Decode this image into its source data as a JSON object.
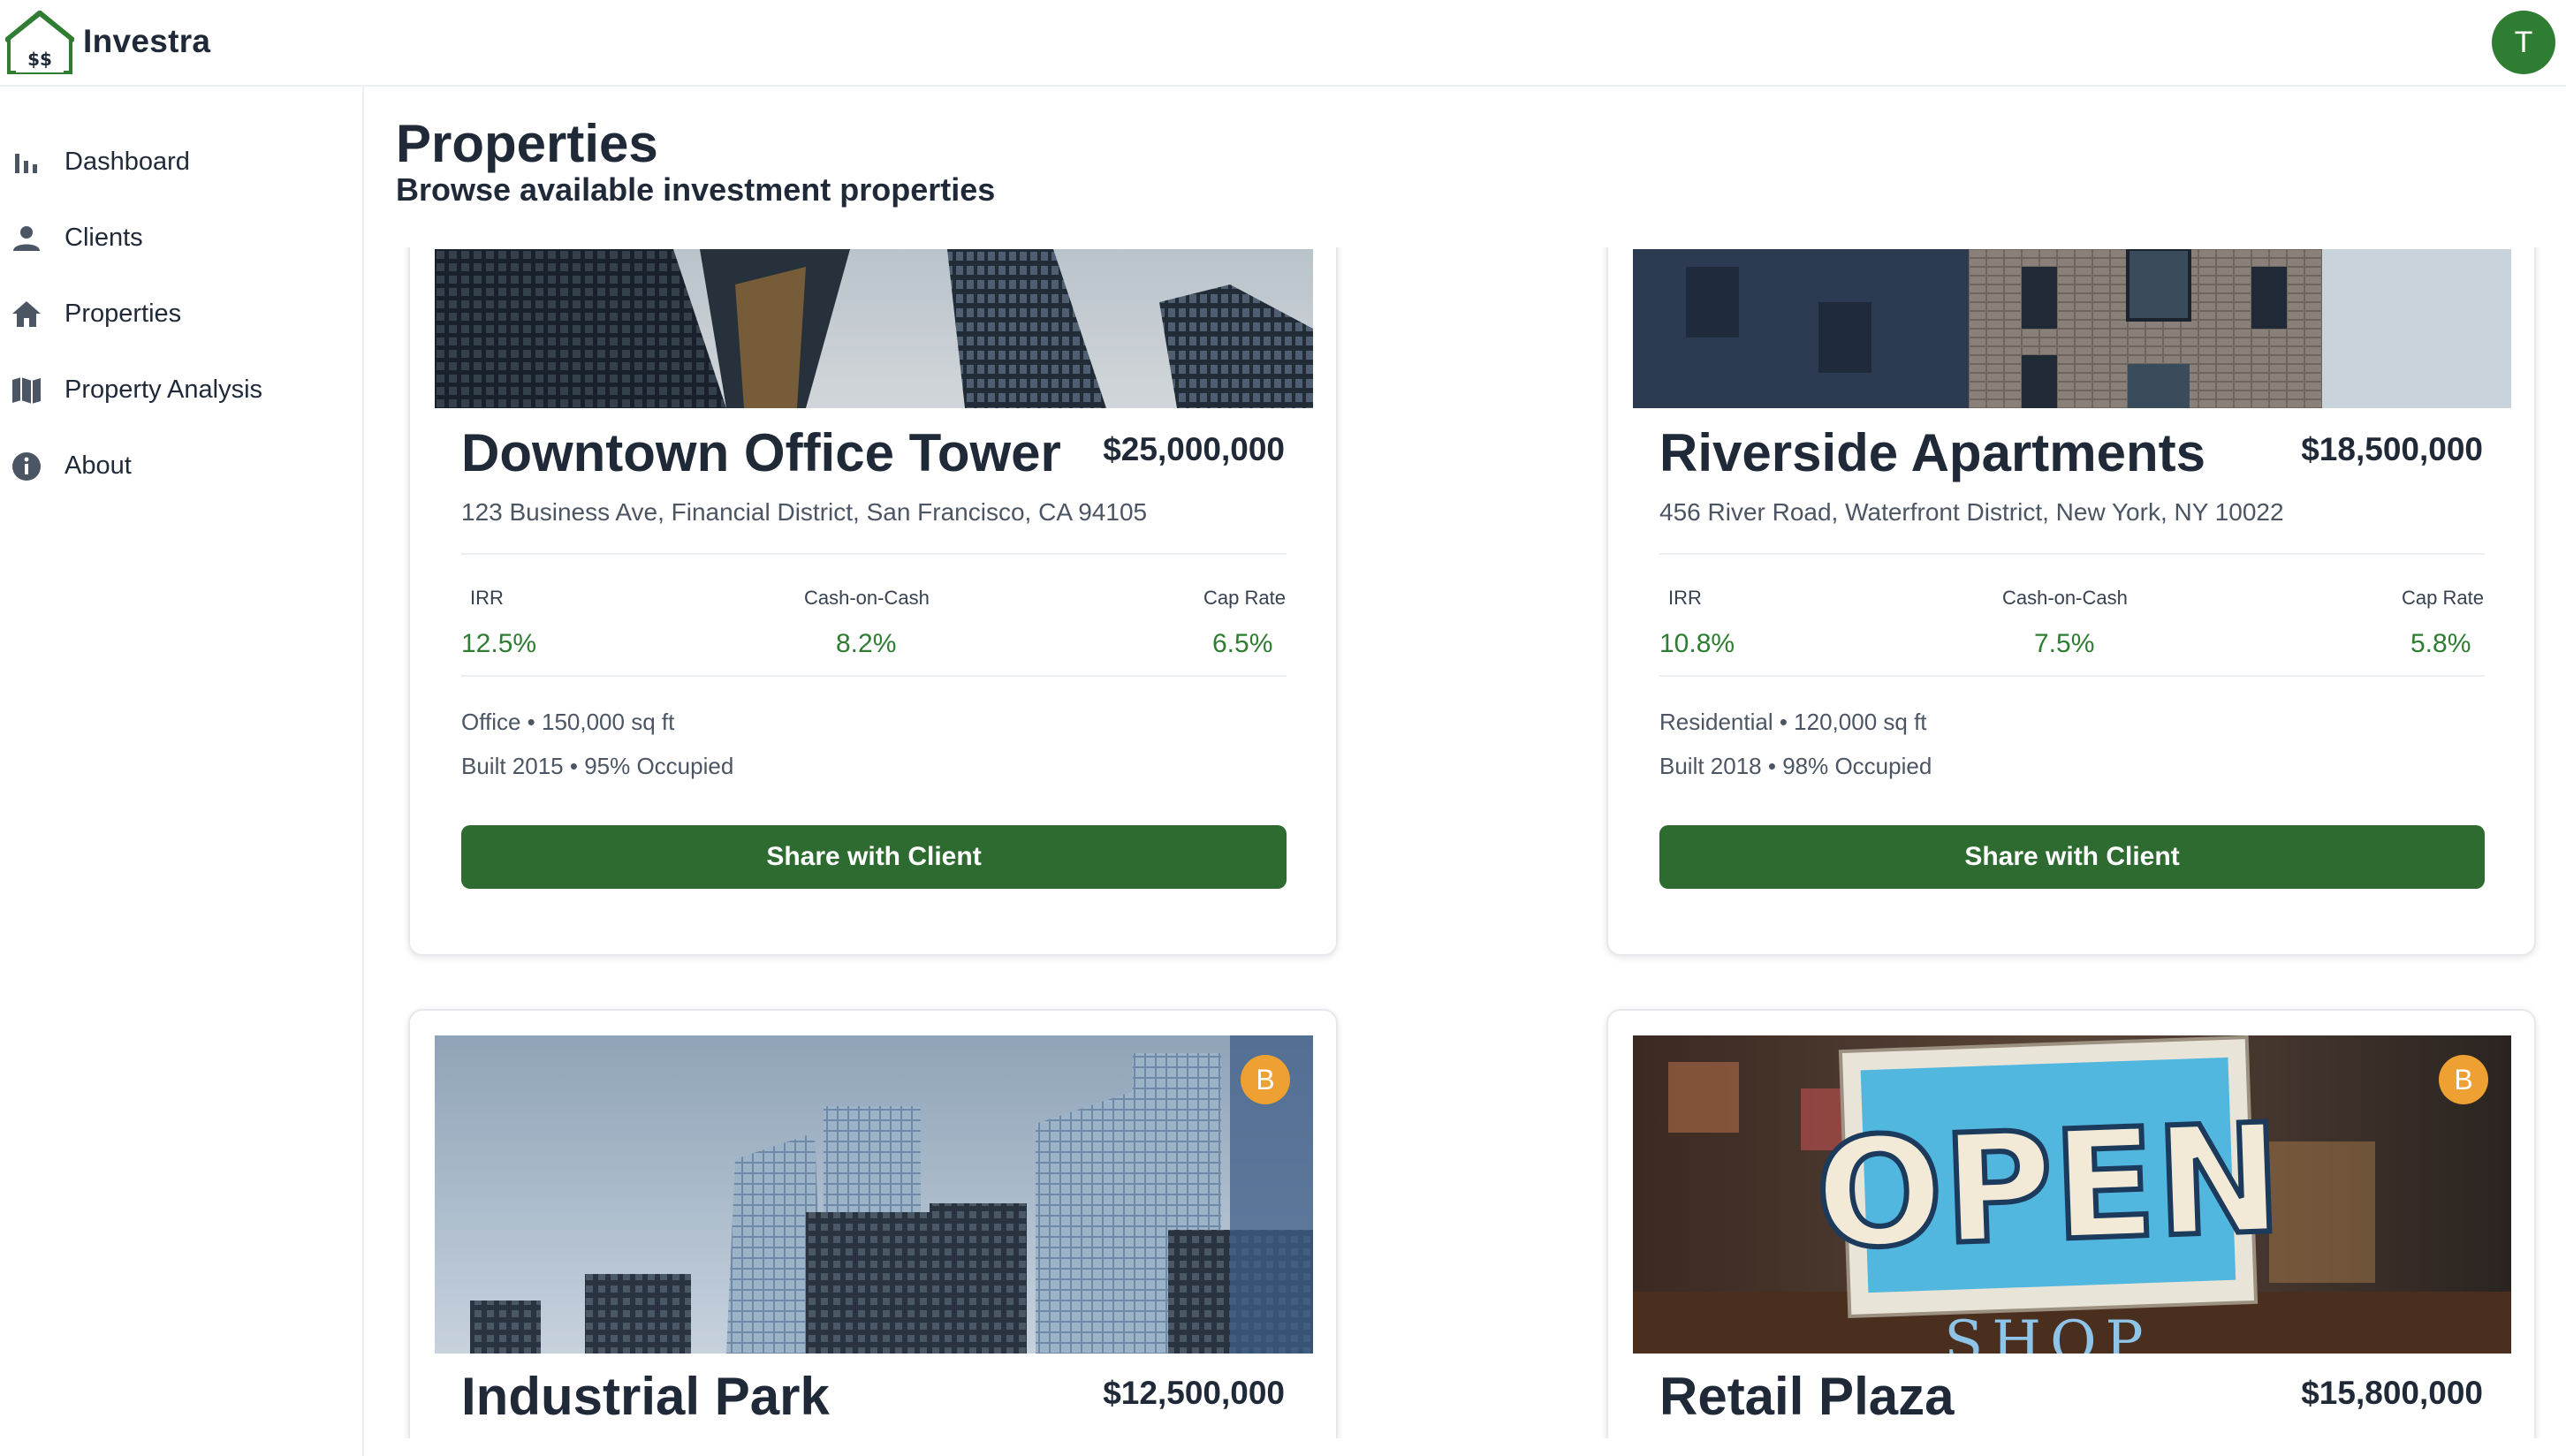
{
  "app": {
    "brand": "Investra",
    "user_initial": "T"
  },
  "sidebar": {
    "items": [
      {
        "label": "Dashboard",
        "icon": "bar-chart-icon"
      },
      {
        "label": "Clients",
        "icon": "person-icon"
      },
      {
        "label": "Properties",
        "icon": "home-icon"
      },
      {
        "label": "Property Analysis",
        "icon": "map-icon"
      },
      {
        "label": "About",
        "icon": "info-icon"
      }
    ]
  },
  "header": {
    "title": "Properties",
    "subtitle": "Browse available investment properties"
  },
  "metric_labels": {
    "irr": "IRR",
    "coc": "Cash-on-Cash",
    "cap": "Cap Rate"
  },
  "share_label": "Share with Client",
  "properties": [
    {
      "name": "Downtown Office Tower",
      "price": "$25,000,000",
      "address": "123 Business Ave, Financial District, San Francisco, CA 94105",
      "irr": "12.5%",
      "coc": "8.2%",
      "cap": "6.5%",
      "detail1": "Office • 150,000 sq ft",
      "detail2": "Built 2015 • 95% Occupied"
    },
    {
      "name": "Riverside Apartments",
      "price": "$18,500,000",
      "address": "456 River Road, Waterfront District, New York, NY 10022",
      "irr": "10.8%",
      "coc": "7.5%",
      "cap": "5.8%",
      "detail1": "Residential • 120,000 sq ft",
      "detail2": "Built 2018 • 98% Occupied"
    },
    {
      "name": "Industrial Park",
      "price": "$12,500,000",
      "badge": "B"
    },
    {
      "name": "Retail Plaza",
      "price": "$15,800,000",
      "badge": "B",
      "photo_sign_text": "OPEN",
      "photo_sign_subtext": "SHOP"
    }
  ],
  "colors": {
    "accent": "#2e7d32",
    "button": "#2e6b30",
    "badge": "#eea032"
  }
}
